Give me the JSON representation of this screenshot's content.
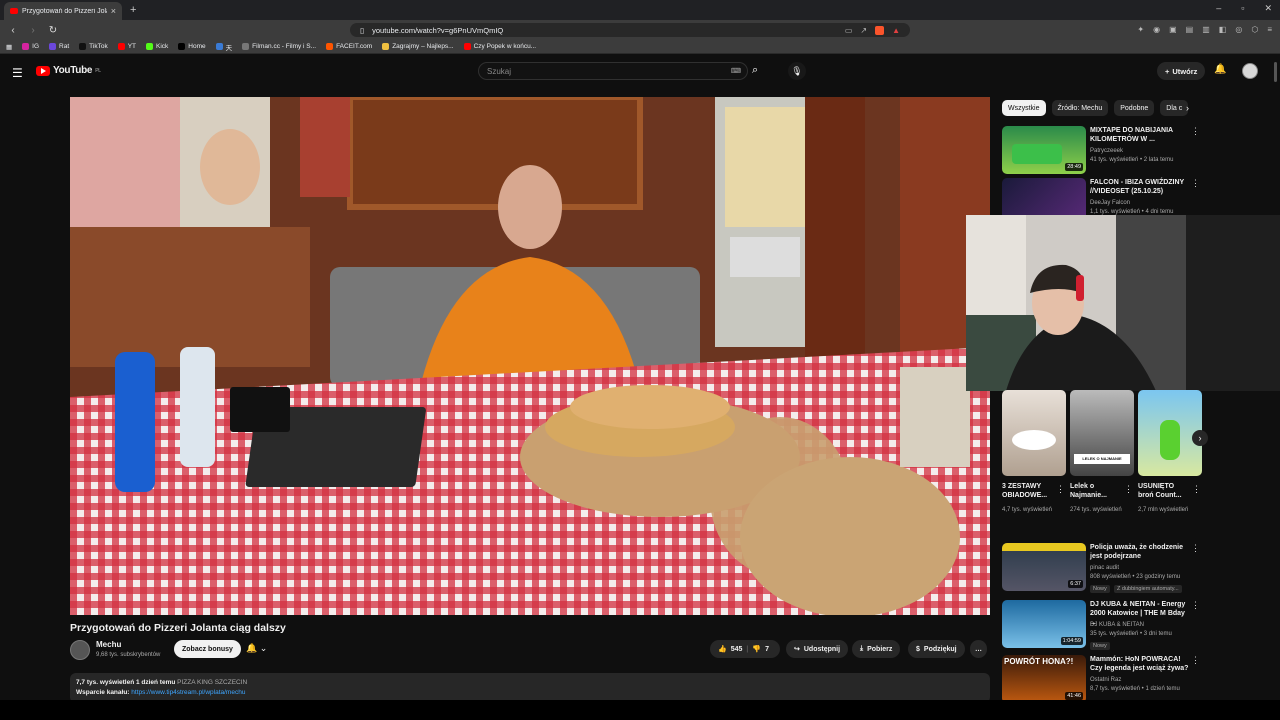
{
  "browser": {
    "tab_title": "Przygotowań do Pizzeri Jolan...",
    "tab_close": "×",
    "new_tab": "+",
    "url": "youtube.com/watch?v=g6PnUVmQmIQ",
    "window_controls": [
      "–",
      "▫",
      "✕"
    ],
    "nav": {
      "back": "‹",
      "forward": "›",
      "reload": "↻"
    },
    "bookmarks": [
      {
        "label": "IG",
        "color": "#d6249f"
      },
      {
        "label": "Rat",
        "color": "#6b47dc"
      },
      {
        "label": "TikTok",
        "color": "#111111"
      },
      {
        "label": "YT",
        "color": "#ff0000"
      },
      {
        "label": "Kick",
        "color": "#53fc18"
      },
      {
        "label": "Home",
        "color": "#000000"
      },
      {
        "label": "天",
        "color": "#3a7bd5"
      },
      {
        "label": "Filman.cc - Filmy i S...",
        "color": "#777777"
      },
      {
        "label": "FACEIT.com",
        "color": "#ff5500"
      },
      {
        "label": "Zagrajmy – Najleps...",
        "color": "#f0c040"
      },
      {
        "label": "Czy Popek w końcu...",
        "color": "#ff0000"
      }
    ]
  },
  "youtube": {
    "logo": "YouTube",
    "logo_region": "PL",
    "search_placeholder": "Szukaj",
    "create_label": "Utwórz",
    "video": {
      "title": "Przygotowań do Pizzeri Jolanta ciąg dalszy",
      "channel": "Mechu",
      "subscribers": "9,68 tys. subskrybentów",
      "bonus_button": "Zobacz bonusy",
      "likes": "545",
      "dislikes": "7",
      "share": "Udostępnij",
      "download": "Pobierz",
      "thanks": "Podziękuj",
      "more": "…",
      "desc_stats": "7,7 tys. wyświetleń  1 dzień temu",
      "desc_tag": "PIZZA KING SZCZECIN",
      "desc_support": "Wsparcie kanału:",
      "desc_link": "https://www.tip4stream.pl/wplata/mechu"
    },
    "chips": [
      "Wszystkie",
      "Źródło: Mechu",
      "Podobne",
      "Dla c"
    ],
    "recommendations": [
      {
        "title": "MIXTAPE DO NABIJANIA KILOMETRÓW W ...",
        "channel": "Patryczeeek",
        "meta": "41 tys. wyświetleń • 2 lata temu",
        "duration": "28:49"
      },
      {
        "title": "FALCON - IBIZA GWIŹDZINY //VIDEOSET (25.10.25)",
        "channel": "DeeJay Falcon",
        "meta": "1,1 tys. wyświetleń • 4 dni temu",
        "duration": ""
      },
      {
        "title": "Policja uważa, że chodzenie jest podejrzane",
        "channel": "pinac audit",
        "meta": "808 wyświetleń • 23 godziny temu",
        "duration": "6:37",
        "badge": "Nowy",
        "badge2": "Z dubbingiem automaty..."
      },
      {
        "title": "DJ KUBA & NEITAN - Energy 2000 Katowice | THE M Bday ...",
        "channel": "DJ KUBA & NEITAN",
        "meta": "35 tys. wyświetleń • 3 dni temu",
        "duration": "1:04:59",
        "badge": "Nowy"
      },
      {
        "title": "Mammón: HoN POWRACA! Czy legenda jest wciąż żywa?",
        "channel": "Ostatni Raz",
        "meta": "8,7 tys. wyświetleń • 1 dzień temu",
        "duration": "41:46",
        "thumb_text": "POWRÓT HONA?!"
      }
    ],
    "shorts": [
      {
        "title": "3 ZESTAWY OBIADOWE...",
        "meta": "4,7 tys. wyświetleń"
      },
      {
        "title": "Lelek o Najmanie...",
        "meta": "274 tys. wyświetleń",
        "thumb_text": "LELEK O NAJMANIE"
      },
      {
        "title": "USUNIĘTO broń Count...",
        "meta": "2,7 mln wyświetleń"
      }
    ]
  }
}
